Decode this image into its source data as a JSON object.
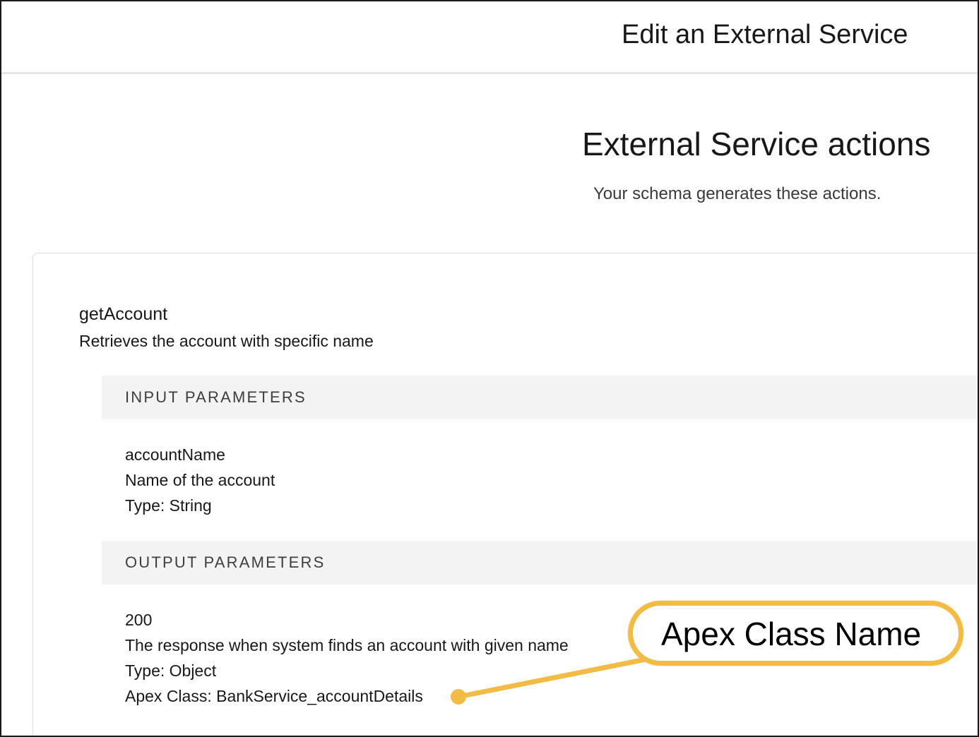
{
  "header": {
    "title": "Edit an External Service"
  },
  "section": {
    "title": "External Service actions",
    "subtitle": "Your schema generates these actions."
  },
  "action": {
    "name": "getAccount",
    "description": "Retrieves the account with specific name",
    "input_parameters": {
      "heading": "INPUT PARAMETERS",
      "name": "accountName",
      "description": "Name of the account",
      "type": "Type: String"
    },
    "output_parameters": {
      "heading": "OUTPUT PARAMETERS",
      "code": "200",
      "description": "The response when system finds an account with given name",
      "type": "Type: Object",
      "apex_class": "Apex Class: BankService_accountDetails"
    }
  },
  "annotation": {
    "label": "Apex Class Name",
    "color": "#f2bb43"
  }
}
